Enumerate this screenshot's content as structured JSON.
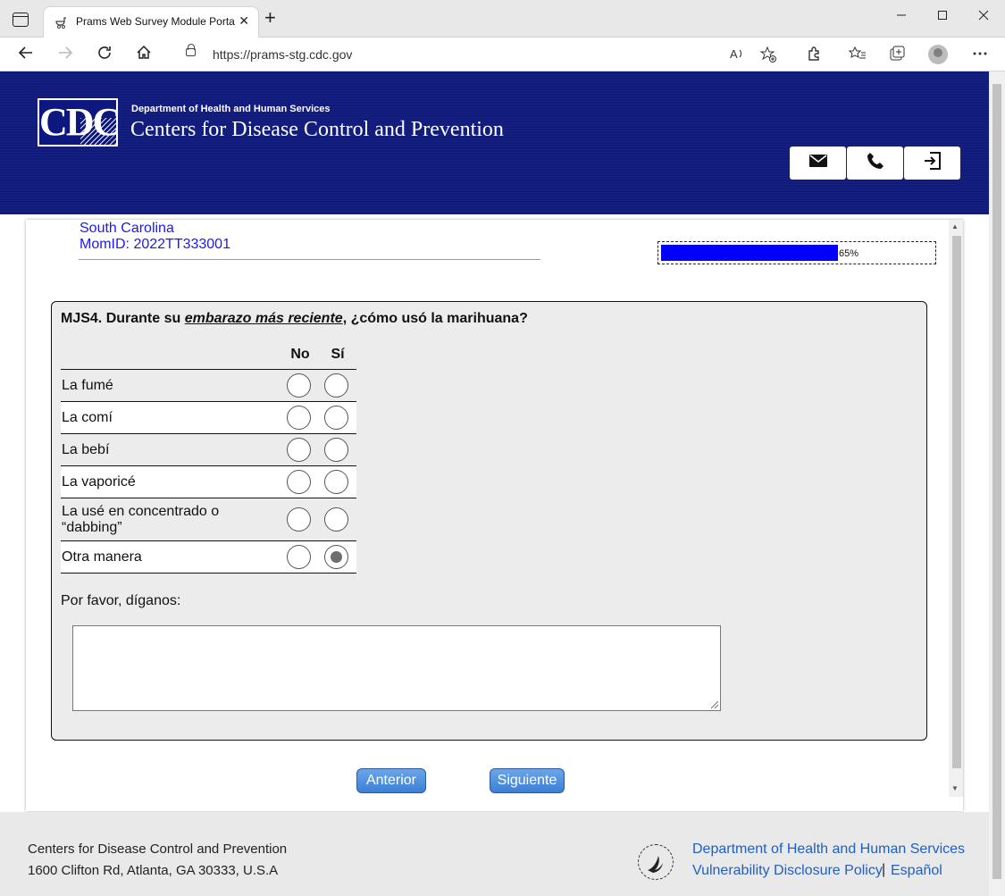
{
  "browser": {
    "tab_title": "Prams Web Survey Module Portal",
    "url": "https://prams-stg.cdc.gov",
    "new_tab_symbol": "+",
    "close_symbol": "✕"
  },
  "header": {
    "logo_text": "CDC",
    "department": "Department of Health and Human Services",
    "agency": "Centers for Disease Control and Prevention",
    "buttons": [
      "mail-icon",
      "phone-icon",
      "logout-icon"
    ]
  },
  "respondent": {
    "state": "South Carolina",
    "mom_id": "MomID: 2022TT333001"
  },
  "progress": {
    "percent": 65,
    "label": "65%"
  },
  "question": {
    "prefix": "MJS4. Durante su ",
    "emphasis": "embarazo más reciente",
    "suffix": ", ¿cómo usó la marihuana?",
    "columns": [
      "No",
      "Sí"
    ],
    "rows": [
      {
        "label": "La fumé",
        "selected": null
      },
      {
        "label": "La comí",
        "selected": null
      },
      {
        "label": "La bebí",
        "selected": null
      },
      {
        "label": "La vaporicé",
        "selected": null
      },
      {
        "label": "La usé en concentrado o “dabbing”",
        "selected": null
      },
      {
        "label": "Otra manera",
        "selected": "Sí"
      }
    ],
    "followup_prompt": "Por favor, díganos:",
    "followup_value": ""
  },
  "nav": {
    "previous": "Anterior",
    "next": "Siguiente"
  },
  "footer": {
    "org": "Centers for Disease Control and Prevention",
    "address": "1600 Clifton Rd, Atlanta, GA 30333, U.S.A",
    "link_hhs": "Department of Health and Human Services",
    "link_vdp": "Vulnerability Disclosure Policy",
    "separator": "|",
    "link_es": "Español"
  },
  "colors": {
    "header_bg": "#101b7c",
    "link": "#1a1aee",
    "progress_fill": "#0000ff",
    "button": "#3b7fd6"
  }
}
